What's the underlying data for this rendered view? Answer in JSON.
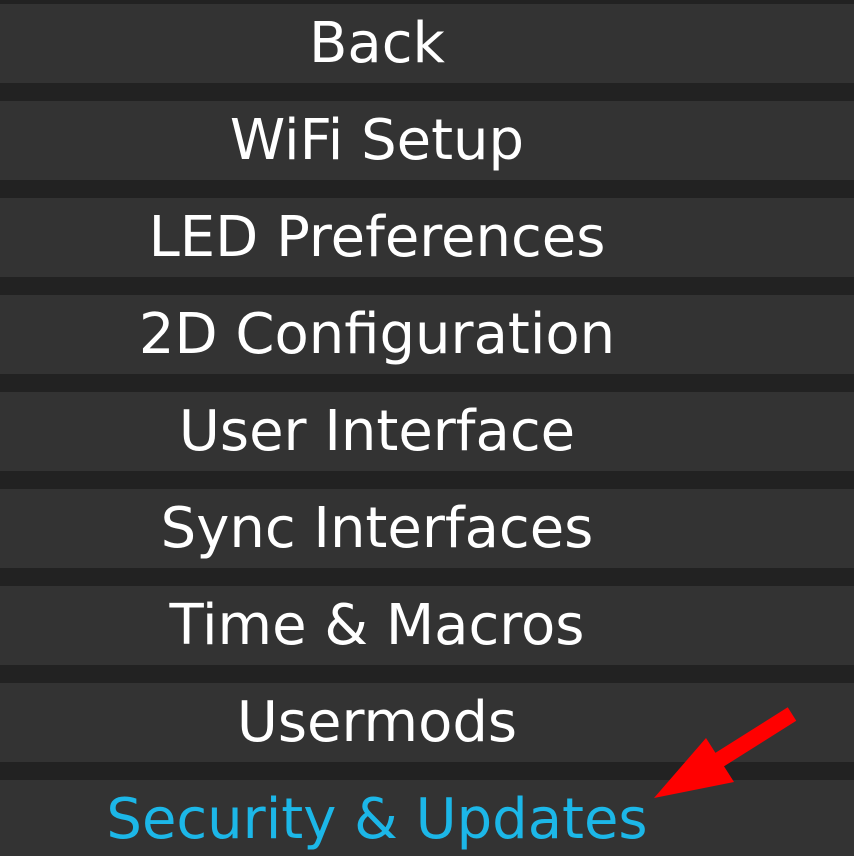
{
  "menu": {
    "items": [
      {
        "label": "Back"
      },
      {
        "label": "WiFi Setup"
      },
      {
        "label": "LED Preferences"
      },
      {
        "label": "2D Configuration"
      },
      {
        "label": "User Interface"
      },
      {
        "label": "Sync Interfaces"
      },
      {
        "label": "Time & Macros"
      },
      {
        "label": "Usermods"
      },
      {
        "label": "Security & Updates"
      }
    ],
    "active_item": "Security & Updates"
  },
  "colors": {
    "background": "#222222",
    "button": "#333333",
    "text": "#ffffff",
    "active_text": "#1cb7e8",
    "annotation_arrow": "#ff0000"
  },
  "annotation": {
    "icon": "red-arrow-icon"
  }
}
